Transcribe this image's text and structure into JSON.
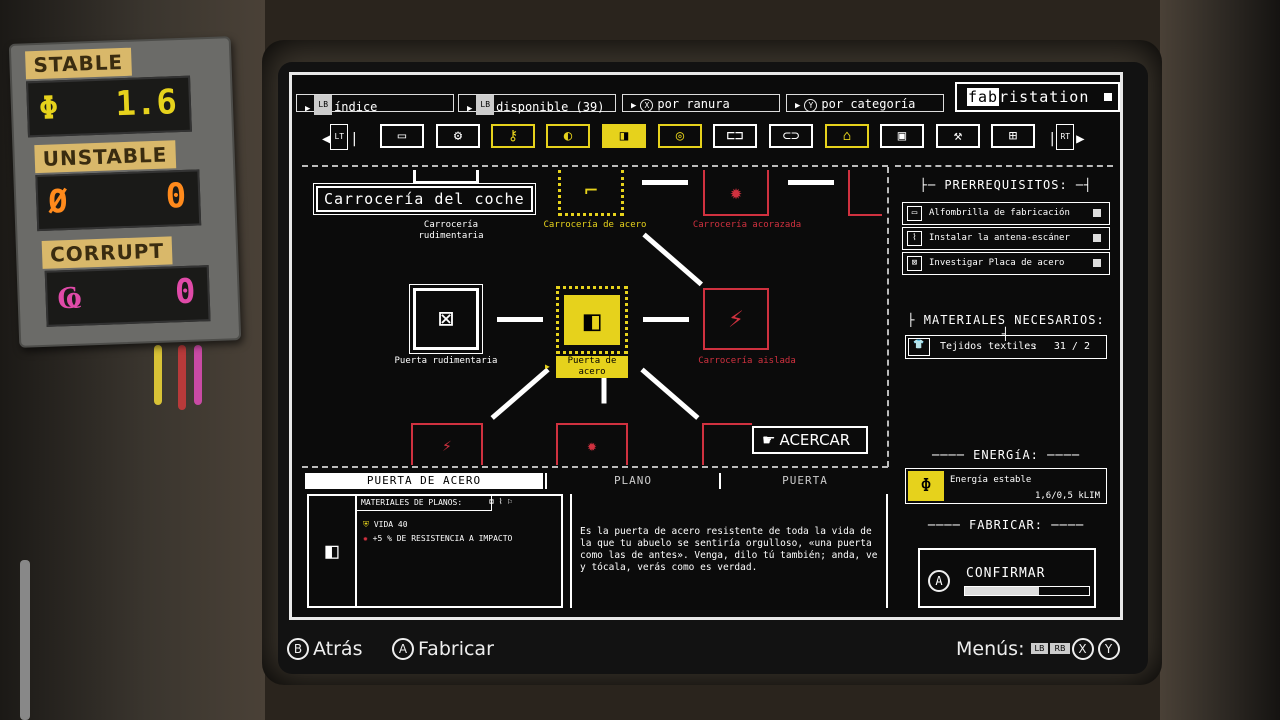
{
  "meter": {
    "stable_label": "STABLE",
    "stable_value": "1.6",
    "unstable_label": "UNSTABLE",
    "unstable_value": "0",
    "corrupt_label": "CORRUPT",
    "corrupt_value": "0",
    "colors": {
      "stable": "#e6d21c",
      "unstable": "#ff8a1c",
      "corrupt": "#e04aa8"
    }
  },
  "topbar": {
    "tabs": [
      {
        "label": "índice",
        "icon": "LB"
      },
      {
        "label": "disponible (39)",
        "icon": "LB"
      },
      {
        "label": "por ranura",
        "icon": "X"
      },
      {
        "label": "por categoría",
        "icon": "Y"
      }
    ],
    "brand_prefix": "fab",
    "brand_suffix": "ristation"
  },
  "categories": {
    "left_bumper": "LT",
    "right_bumper": "RT",
    "icons": [
      "battery-icon",
      "gear-icon",
      "key-icon",
      "headlight-icon",
      "door-icon",
      "tire-icon",
      "car-front-icon",
      "car-side-icon",
      "car-roof-icon",
      "engine-icon",
      "tool-icon",
      "motor-icon"
    ]
  },
  "tree": {
    "tooltip": "Carrocería del coche",
    "nodes": {
      "carroceria_rudimentaria": "Carrocería rudimentaria",
      "carroceria_acero": "Carrocería de acero",
      "carroceria_acorazada": "Carrocería acorazada",
      "puerta_rudimentaria": "Puerta rudimentaria",
      "puerta_acero": "Puerta de acero",
      "carroceria_aislada": "Carrocería aislada"
    },
    "zoom_label": "ACERCAR"
  },
  "right_panel": {
    "prereq_title": "PRERREQUISITOS:",
    "prereqs": [
      "Alfombrilla de fabricación",
      "Instalar la antena-escáner",
      "Investigar Placa de acero"
    ],
    "materials_title": "MATERIALES NECESARIOS:",
    "material_name": "Tejidos textiles",
    "material_sep": ":",
    "material_count": "31 / 2",
    "energy_title": "ENERGíA:",
    "energy_name": "Energía estable",
    "energy_value": "1,6/0,5 kLIM",
    "fabricate_title": "FABRICAR:",
    "confirm_label": "CONFIRMAR",
    "confirm_progress": 0.6
  },
  "detail": {
    "tabs": [
      "PUERTA DE ACERO",
      "PLANO",
      "PUERTA"
    ],
    "materials_label": "MATERIALES DE PLANOS:",
    "stat_life": "VIDA  40",
    "stat_resist": "+5 % DE RESISTENCIA A IMPACTO",
    "description": "Es la puerta de acero resistente de toda la vida de la que tu abuelo se sentiría orgulloso, «una puerta como las de antes». Venga, dilo tú también; anda, ve y tócala, verás como es verdad."
  },
  "hints": {
    "back_btn": "B",
    "back": "Atrás",
    "fab_btn": "A",
    "fabricate": "Fabricar",
    "menus": "Menús:",
    "lb": "LB",
    "rb": "RB",
    "x": "X",
    "y": "Y"
  }
}
